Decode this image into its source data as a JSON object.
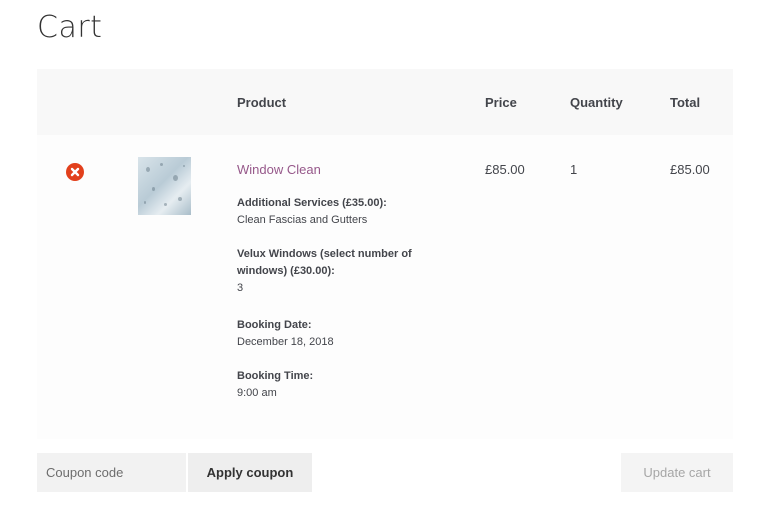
{
  "page": {
    "title": "Cart"
  },
  "table": {
    "headers": {
      "product": "Product",
      "price": "Price",
      "quantity": "Quantity",
      "total": "Total"
    },
    "row": {
      "remove_icon": "remove-circle-icon",
      "thumbnail": "product-thumbnail",
      "product_name": "Window Clean",
      "meta": [
        {
          "key": "Additional Services (£35.00):",
          "value": "Clean Fascias and Gutters"
        },
        {
          "key": "Velux Windows (select number of windows) (£30.00):",
          "value": "3"
        },
        {
          "key": "Booking Date:",
          "value": "December 18, 2018"
        },
        {
          "key": "Booking Time:",
          "value": "9:00 am"
        }
      ],
      "price": "£85.00",
      "quantity": "1",
      "total": "£85.00"
    }
  },
  "actions": {
    "coupon_placeholder": "Coupon code",
    "apply_label": "Apply coupon",
    "update_label": "Update cart"
  },
  "colors": {
    "link": "#96588a",
    "remove": "#e2401c",
    "header_bg": "#f8f8f8"
  }
}
